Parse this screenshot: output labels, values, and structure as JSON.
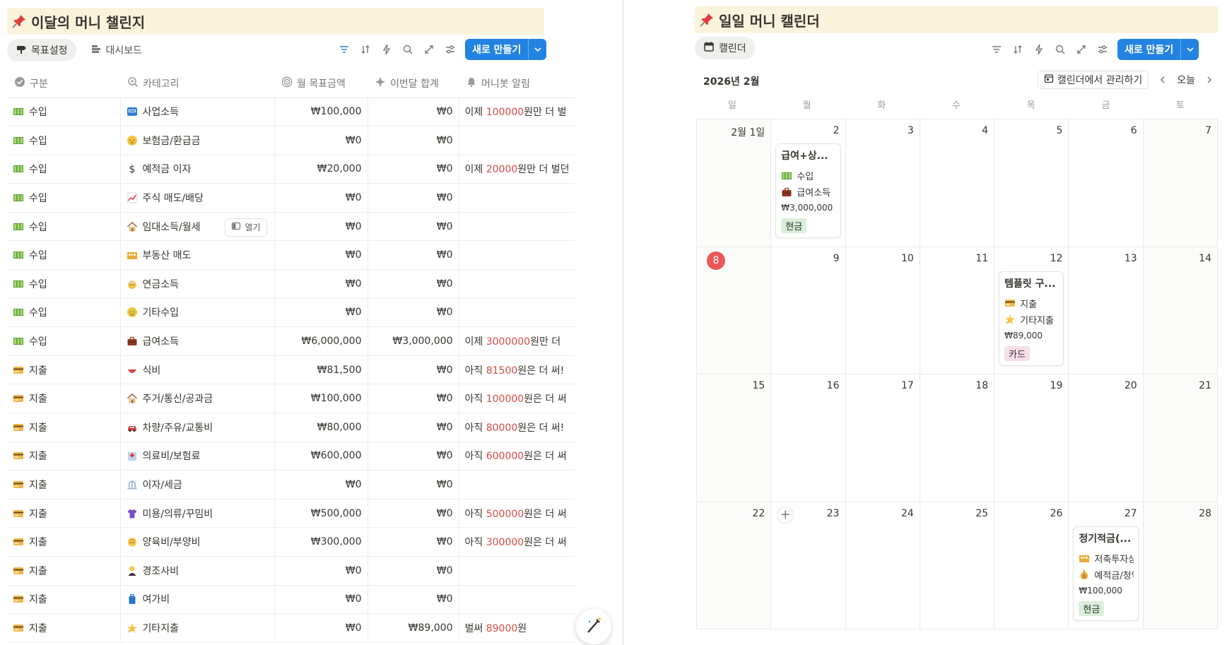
{
  "left": {
    "title": "이달의 머니 챌린지",
    "tabs": [
      "목표설정",
      "대시보드"
    ],
    "new_button": "새로 만들기",
    "columns": [
      "구분",
      "카테고리",
      "월 목표금액",
      "이번달 합계",
      "머니봇 알림"
    ],
    "open_label": "열기",
    "rows": [
      {
        "type": "수입",
        "type_icon": "money-bills-icon",
        "cat": "사업소득",
        "cat_icon": "atm-icon",
        "goal": "₩100,000",
        "total": "₩0",
        "alert_pre": "이제 ",
        "alert_num": "100000",
        "alert_post": "원만 더 벌"
      },
      {
        "type": "수입",
        "type_icon": "money-bills-icon",
        "cat": "보험금/환급금",
        "cat_icon": "relieved-face-icon",
        "goal": "₩0",
        "total": "₩0",
        "alert_pre": "",
        "alert_num": "",
        "alert_post": ""
      },
      {
        "type": "수입",
        "type_icon": "money-bills-icon",
        "cat": "예적금 이자",
        "cat_icon": "dollar-sign-icon",
        "goal": "₩20,000",
        "total": "₩0",
        "alert_pre": "이제 ",
        "alert_num": "20000",
        "alert_post": "원만 더 벌던"
      },
      {
        "type": "수입",
        "type_icon": "money-bills-icon",
        "cat": "주식 매도/배당",
        "cat_icon": "chart-up-icon",
        "goal": "₩0",
        "total": "₩0",
        "alert_pre": "",
        "alert_num": "",
        "alert_post": ""
      },
      {
        "type": "수입",
        "type_icon": "money-bills-icon",
        "cat": "임대소득/월세",
        "cat_icon": "house-icon",
        "goal": "₩0",
        "total": "₩0",
        "alert_pre": "",
        "alert_num": "",
        "alert_post": ""
      },
      {
        "type": "수입",
        "type_icon": "money-bills-icon",
        "cat": "부동산 매도",
        "cat_icon": "building-blocks-icon",
        "goal": "₩0",
        "total": "₩0",
        "alert_pre": "",
        "alert_num": "",
        "alert_post": ""
      },
      {
        "type": "수입",
        "type_icon": "money-bills-icon",
        "cat": "연금소득",
        "cat_icon": "old-man-icon",
        "goal": "₩0",
        "total": "₩0",
        "alert_pre": "",
        "alert_num": "",
        "alert_post": ""
      },
      {
        "type": "수입",
        "type_icon": "money-bills-icon",
        "cat": "기타수입",
        "cat_icon": "money-face-icon",
        "goal": "₩0",
        "total": "₩0",
        "alert_pre": "",
        "alert_num": "",
        "alert_post": ""
      },
      {
        "type": "수입",
        "type_icon": "money-bills-icon",
        "cat": "급여소득",
        "cat_icon": "briefcase-icon",
        "goal": "₩6,000,000",
        "total": "₩3,000,000",
        "alert_pre": "이제 ",
        "alert_num": "3000000",
        "alert_post": "원만 더"
      },
      {
        "type": "지출",
        "type_icon": "credit-card-icon",
        "cat": "식비",
        "cat_icon": "rice-bowl-icon",
        "goal": "₩81,500",
        "total": "₩0",
        "alert_pre": "아직 ",
        "alert_num": "81500",
        "alert_post": "원은 더 써!"
      },
      {
        "type": "지출",
        "type_icon": "credit-card-icon",
        "cat": "주거/통신/공과금",
        "cat_icon": "house-icon",
        "goal": "₩100,000",
        "total": "₩0",
        "alert_pre": "아직 ",
        "alert_num": "100000",
        "alert_post": "원은 더 써"
      },
      {
        "type": "지출",
        "type_icon": "credit-card-icon",
        "cat": "차량/주유/교통비",
        "cat_icon": "car-icon",
        "goal": "₩80,000",
        "total": "₩0",
        "alert_pre": "아직 ",
        "alert_num": "80000",
        "alert_post": "원은 더 써!"
      },
      {
        "type": "지출",
        "type_icon": "credit-card-icon",
        "cat": "의료비/보험료",
        "cat_icon": "hospital-icon",
        "goal": "₩600,000",
        "total": "₩0",
        "alert_pre": "아직 ",
        "alert_num": "600000",
        "alert_post": "원은 더 써"
      },
      {
        "type": "지출",
        "type_icon": "credit-card-icon",
        "cat": "이자/세금",
        "cat_icon": "bank-icon",
        "goal": "₩0",
        "total": "₩0",
        "alert_pre": "",
        "alert_num": "",
        "alert_post": ""
      },
      {
        "type": "지출",
        "type_icon": "credit-card-icon",
        "cat": "미용/의류/꾸밈비",
        "cat_icon": "tshirt-icon",
        "goal": "₩500,000",
        "total": "₩0",
        "alert_pre": "아직 ",
        "alert_num": "500000",
        "alert_post": "원은 더 써"
      },
      {
        "type": "지출",
        "type_icon": "credit-card-icon",
        "cat": "양육비/부양비",
        "cat_icon": "child-face-icon",
        "goal": "₩300,000",
        "total": "₩0",
        "alert_pre": "아직 ",
        "alert_num": "300000",
        "alert_post": "원은 더 써"
      },
      {
        "type": "지출",
        "type_icon": "credit-card-icon",
        "cat": "경조사비",
        "cat_icon": "person-icon",
        "goal": "₩0",
        "total": "₩0",
        "alert_pre": "",
        "alert_num": "",
        "alert_post": ""
      },
      {
        "type": "지출",
        "type_icon": "credit-card-icon",
        "cat": "여가비",
        "cat_icon": "luggage-icon",
        "goal": "₩0",
        "total": "₩0",
        "alert_pre": "",
        "alert_num": "",
        "alert_post": ""
      },
      {
        "type": "지출",
        "type_icon": "credit-card-icon",
        "cat": "기타지출",
        "cat_icon": "dizzy-icon",
        "goal": "₩0",
        "total": "₩89,000",
        "alert_pre": "벌써 ",
        "alert_num": "89000",
        "alert_post": "원"
      }
    ]
  },
  "right": {
    "title": "일일 머니 캘린더",
    "tab": "캘린더",
    "new_button": "새로 만들기",
    "month_label": "2026년 2월",
    "manage_label": "캘린더에서 관리하기",
    "today_label": "오늘",
    "weekdays": [
      "일",
      "월",
      "화",
      "수",
      "목",
      "금",
      "토"
    ],
    "days": [
      "2월 1일",
      "2",
      "3",
      "4",
      "5",
      "6",
      "7",
      "8",
      "9",
      "10",
      "11",
      "12",
      "13",
      "14",
      "15",
      "16",
      "17",
      "18",
      "19",
      "20",
      "21",
      "22",
      "23",
      "24",
      "25",
      "26",
      "27",
      "28"
    ],
    "today_index": 7,
    "add_index": 22,
    "events": [
      {
        "day_index": 1,
        "title": "급여+상...",
        "rows": [
          {
            "icon": "money-bills-icon",
            "text": "수입"
          },
          {
            "icon": "briefcase-icon",
            "text": "급여소득"
          }
        ],
        "amount": "₩3,000,000",
        "tag": "현금",
        "tag_kind": "cash"
      },
      {
        "day_index": 11,
        "title": "템플릿 구...",
        "rows": [
          {
            "icon": "credit-card-icon",
            "text": "지출"
          },
          {
            "icon": "dizzy-icon",
            "text": "기타지출"
          }
        ],
        "amount": "₩89,000",
        "tag": "카드",
        "tag_kind": "card"
      },
      {
        "day_index": 26,
        "title": "정기적금(...",
        "rows": [
          {
            "icon": "building-blocks-icon",
            "text": "저축투자상품"
          },
          {
            "icon": "money-bag-icon",
            "text": "예적금/청약"
          }
        ],
        "amount": "₩100,000",
        "tag": "현금",
        "tag_kind": "cash"
      }
    ]
  },
  "colors": {
    "accent": "#2383e2",
    "alert_red": "#d44c47",
    "title_bg": "#fbf3db",
    "today": "#eb5757"
  }
}
